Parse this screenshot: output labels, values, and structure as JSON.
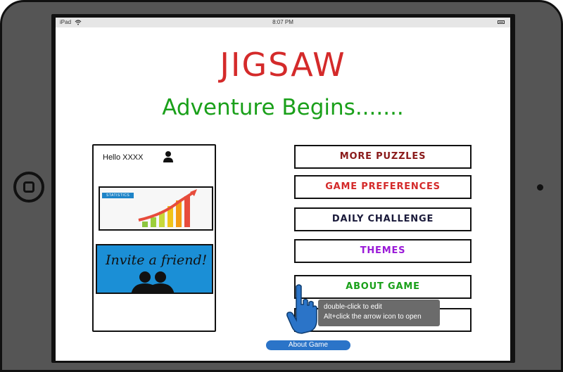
{
  "statusbar": {
    "carrier": "iPad",
    "time": "8:07 PM"
  },
  "app": {
    "title": "JIGSAW",
    "subtitle": "Adventure Begins......."
  },
  "profile_panel": {
    "greeting": "Hello XXXX",
    "stats_card_tag": "STATISTICS",
    "invite_card_text": "Invite a friend!"
  },
  "menu": [
    {
      "label": "MORE PUZZLES",
      "color": "#8a1a1a"
    },
    {
      "label": "GAME PREFERENCES",
      "color": "#d42a2a"
    },
    {
      "label": "DAILY CHALLENGE",
      "color": "#1a1a3a"
    },
    {
      "label": "THEMES",
      "color": "#9a1ad8"
    },
    {
      "label": "ABOUT GAME",
      "color": "#1aa01a"
    }
  ],
  "tooltip": {
    "line1": "double-click to edit",
    "line2": "Alt+click the arrow icon to open"
  },
  "link_pill": {
    "label": "About Game"
  },
  "colors": {
    "device": "#555555",
    "title": "#d42a2a",
    "subtitle": "#1aa01a",
    "invite_bg": "#1b8fd6",
    "pill": "#2b74c8"
  }
}
